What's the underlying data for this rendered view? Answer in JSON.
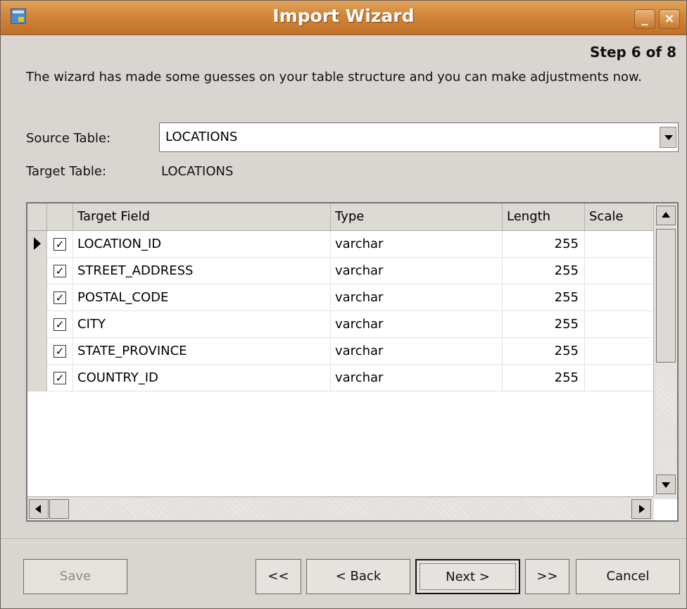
{
  "window": {
    "title": "Import Wizard",
    "minimize_symbol": "_",
    "close_symbol": "×"
  },
  "wizard": {
    "step": "Step 6 of 8",
    "description": "The wizard has made some guesses on your table structure and you can make adjustments now.",
    "source_label": "Source Table:",
    "source_value": "LOCATIONS",
    "target_label": "Target Table:",
    "target_value": "LOCATIONS"
  },
  "table": {
    "columns": [
      "Target Field",
      "Type",
      "Length",
      "Scale"
    ],
    "rows": [
      {
        "selected": true,
        "checked": "✓",
        "field": "LOCATION_ID",
        "type": "varchar",
        "length": "255",
        "scale": ""
      },
      {
        "selected": false,
        "checked": "✓",
        "field": "STREET_ADDRESS",
        "type": "varchar",
        "length": "255",
        "scale": ""
      },
      {
        "selected": false,
        "checked": "✓",
        "field": "POSTAL_CODE",
        "type": "varchar",
        "length": "255",
        "scale": ""
      },
      {
        "selected": false,
        "checked": "✓",
        "field": "CITY",
        "type": "varchar",
        "length": "255",
        "scale": ""
      },
      {
        "selected": false,
        "checked": "✓",
        "field": "STATE_PROVINCE",
        "type": "varchar",
        "length": "255",
        "scale": ""
      },
      {
        "selected": false,
        "checked": "✓",
        "field": "COUNTRY_ID",
        "type": "varchar",
        "length": "255",
        "scale": ""
      }
    ]
  },
  "buttons": {
    "save": "Save",
    "first": "<<",
    "back": "< Back",
    "next": "Next >",
    "last": ">>",
    "cancel": "Cancel"
  },
  "icons": {
    "app": "import-wizard-icon",
    "row_pointer": "row-pointer-icon",
    "checkbox": "checkmark-icon"
  },
  "colors": {
    "titlebar": "#d18638",
    "background": "#d9d5d0",
    "grid_header": "#ddd9d4"
  }
}
